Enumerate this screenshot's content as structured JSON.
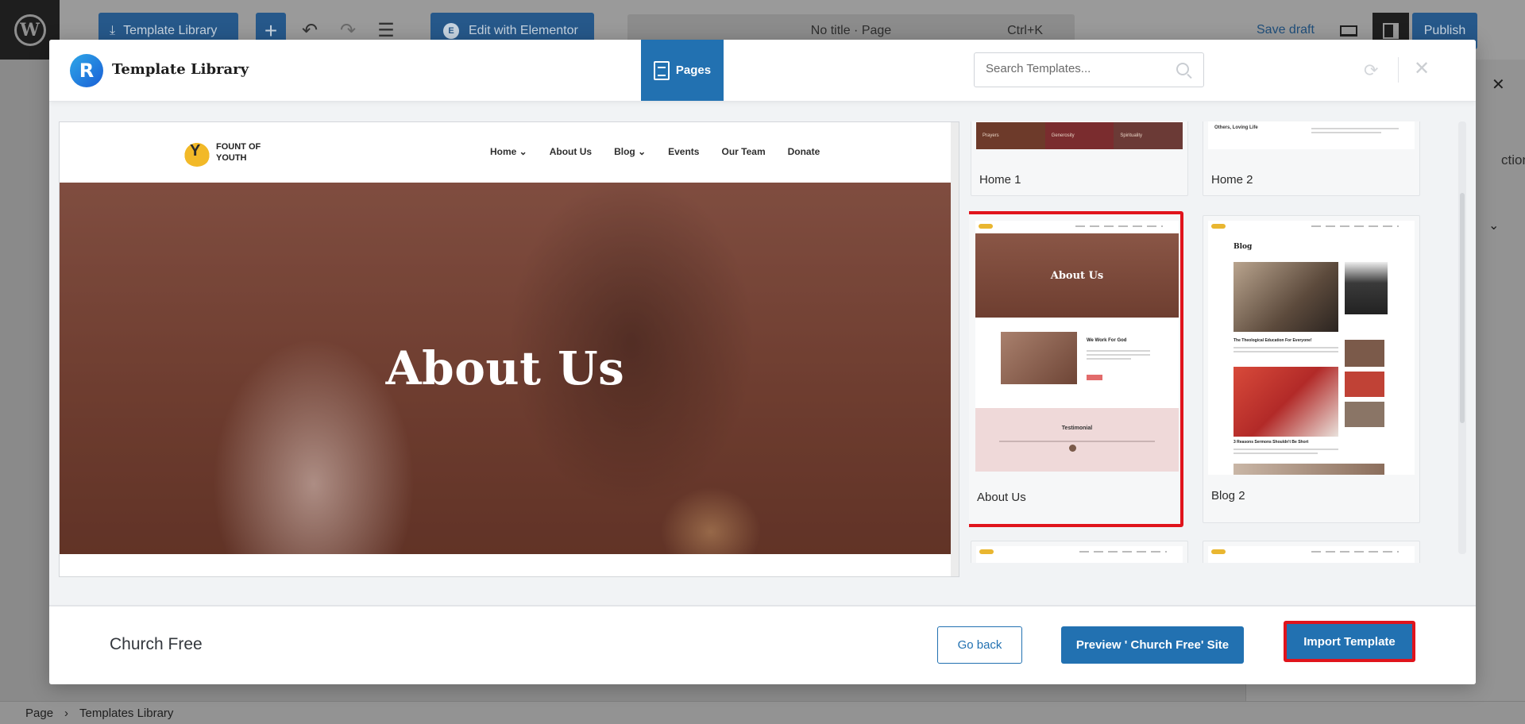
{
  "editor": {
    "template_library_label": "Template Library",
    "edit_with_elementor_label": "Edit with Elementor",
    "command_title": "No title · Page",
    "command_shortcut": "Ctrl+K",
    "save_draft_label": "Save draft",
    "publish_label": "Publish",
    "side_panel_partial_text": "ctions"
  },
  "breadcrumb": {
    "items": [
      "Page",
      "Templates Library"
    ]
  },
  "modal": {
    "brand_title": "Template Library",
    "brand_letter": "R",
    "tab_label": "Pages",
    "search_placeholder": "Search Templates...",
    "preview": {
      "logo_text_line1": "FOUNT OF",
      "logo_text_line2": "YOUTH",
      "nav_items": [
        "Home",
        "About Us",
        "Blog",
        "Events",
        "Our Team",
        "Donate"
      ],
      "hero_title": "About Us"
    },
    "templates": [
      {
        "label": "Home 1"
      },
      {
        "label": "Home 2"
      },
      {
        "label": "About Us",
        "selected": true
      },
      {
        "label": "Blog 2"
      }
    ],
    "thumb_text": {
      "about_hero": "About Us",
      "about_heading": "We Work For God",
      "about_testimonial": "Testimonial",
      "blog_heading": "Blog",
      "blog_post1": "The Theological Education For Everyone!",
      "blog_post2": "3 Reasons Sermons Shouldn't Be Short",
      "home2_text": "Others, Loving Life",
      "home1_captions": [
        "Prayers",
        "Generosity",
        "Spirituality"
      ]
    },
    "footer": {
      "kit_name": "Church Free",
      "go_back_label": "Go back",
      "preview_site_label": "Preview ' Church Free' Site",
      "import_label": "Import Template"
    }
  },
  "colors": {
    "accent": "#2271b1",
    "highlight": "#e0141c"
  }
}
